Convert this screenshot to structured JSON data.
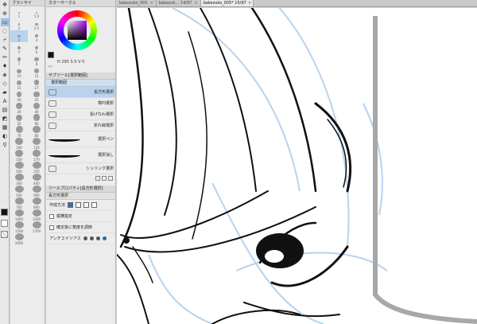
{
  "toolstrip": {
    "tools": [
      "move-icon",
      "zoom-icon",
      "select-icon",
      "selection-icon",
      "eyedropper-icon",
      "pen-icon",
      "brush-icon",
      "eraser-icon",
      "fill-icon",
      "gradient-icon",
      "shape-icon",
      "text-icon",
      "balloon-icon",
      "ruler-icon",
      "blend-icon",
      "lasso-icon",
      "hand-icon"
    ]
  },
  "brushpanel": {
    "title": "ブラシサイ",
    "sizes": [
      "1",
      "1.5",
      "2",
      "2.5",
      "3",
      "4",
      "5",
      "6",
      "7",
      "8",
      "10",
      "12",
      "15",
      "17",
      "20",
      "25",
      "30",
      "40",
      "50",
      "60",
      "70",
      "80",
      "100",
      "120",
      "150",
      "170",
      "200",
      "250",
      "300",
      "400",
      "500",
      "600",
      "700",
      "800",
      "1000",
      "1200",
      "1500",
      "1700",
      "2000"
    ]
  },
  "colorpanel": {
    "title": "カラーサークル",
    "h_label": "H",
    "h_value": "295",
    "s_label": "S",
    "s_value": "0",
    "v_label": "V",
    "v_value": "0",
    "main_color": "#111111"
  },
  "subtool": {
    "title": "サブツール[選択範囲]",
    "group": "選択範囲",
    "items": [
      {
        "label": "長方形選択",
        "selected": true
      },
      {
        "label": "楕円選択",
        "selected": false
      },
      {
        "label": "投げなわ選択",
        "selected": false
      },
      {
        "label": "折れ線選択",
        "selected": false
      },
      {
        "label": "選択ペン",
        "selected": false
      },
      {
        "label": "選択消し",
        "selected": false
      },
      {
        "label": "シュリンク選択",
        "selected": false
      }
    ]
  },
  "props": {
    "title": "ツールプロパティ[長方形選択]",
    "subtitle": "長方形選択",
    "mode_label": "作成方法",
    "aspect_label": "縦横指定",
    "angle_label": "確定後に角度を調節",
    "aa_label": "アンチエイリアス"
  },
  "tabs": [
    {
      "label": "bakezuko_005",
      "active": false
    },
    {
      "label": "bakezuk... 14/97",
      "active": false
    },
    {
      "label": "bakezuko_005* 15/97",
      "active": true
    }
  ]
}
